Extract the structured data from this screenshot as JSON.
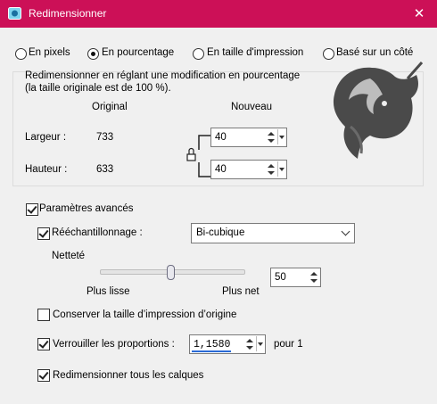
{
  "window": {
    "title": "Redimensionner",
    "close_glyph": "✕",
    "icon": "resize-app-icon",
    "accent": "#cc1057"
  },
  "mode_options": [
    {
      "label": "En pixels",
      "selected": false
    },
    {
      "label": "En pourcentage",
      "selected": true
    },
    {
      "label": "En taille d'impression",
      "selected": false
    },
    {
      "label": "Basé sur un côté",
      "selected": false
    }
  ],
  "group": {
    "description_line1": "Redimensionner en réglant une modification en pourcentage",
    "description_line2": "(la taille originale est de 100 %).",
    "col_original": "Original",
    "col_nouveau": "Nouveau",
    "width_label": "Largeur :",
    "width_original": "733",
    "width_new": "40",
    "height_label": "Hauteur :",
    "height_original": "633",
    "height_new": "40",
    "lock_icon": "lock-icon"
  },
  "advanced": {
    "label": "Paramètres avancés",
    "checked": true,
    "resample_label": "Rééchantillonnage :",
    "resample_checked": true,
    "resample_value": "Bi-cubique",
    "sharpness_label": "Netteté",
    "slider_value_pct": 50,
    "slider_left": "Plus lisse",
    "slider_right": "Plus net",
    "sharpness_value": "50",
    "keep_print_size_label": "Conserver la taille d’impression d’origine",
    "keep_print_size_checked": false,
    "lock_ratio_label": "Verrouiller les proportions :",
    "lock_ratio_checked": true,
    "ratio_value": "1,1580",
    "ratio_suffix": "pour 1",
    "all_layers_label": "Redimensionner tous les calques",
    "all_layers_checked": true
  }
}
